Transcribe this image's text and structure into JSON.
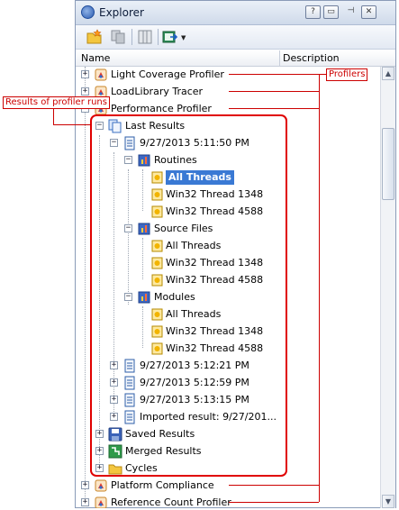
{
  "window": {
    "title": "Explorer"
  },
  "title_buttons": [
    {
      "icon": "help-icon",
      "glyph": "?"
    },
    {
      "icon": "restore-icon",
      "glyph": "▭"
    },
    {
      "icon": "pin-icon",
      "glyph": "⊣"
    },
    {
      "icon": "close-icon",
      "glyph": "✕"
    }
  ],
  "toolbar": {
    "items": [
      "open-folder-icon",
      "copy-icon",
      "columns-icon",
      "export-icon"
    ]
  },
  "header": {
    "name_label": "Name",
    "description_label": "Description"
  },
  "tree": {
    "light_coverage": "Light Coverage Profiler",
    "loadlibrary": "LoadLibrary Tracer",
    "performance": "Performance Profiler",
    "last_results": "Last Results",
    "run1": "9/27/2013 5:11:50 PM",
    "routines": "Routines",
    "all_threads": "All Threads",
    "thread_1348": "Win32 Thread 1348",
    "thread_4588": "Win32 Thread 4588",
    "source_files": "Source Files",
    "modules": "Modules",
    "run2": "9/27/2013 5:12:21 PM",
    "run3": "9/27/2013 5:12:59 PM",
    "run4": "9/27/2013 5:13:15 PM",
    "imported": "Imported result: 9/27/201...",
    "saved_results": "Saved Results",
    "merged_results": "Merged Results",
    "cycles": "Cycles",
    "platform_compliance": "Platform Compliance",
    "reference_count": "Reference Count Profiler"
  },
  "annotations": {
    "profilers": "Profilers",
    "results_of_runs": "Results of profiler runs"
  },
  "colors": {
    "annotation": "#cc0000",
    "selection": "#3a79d4"
  }
}
